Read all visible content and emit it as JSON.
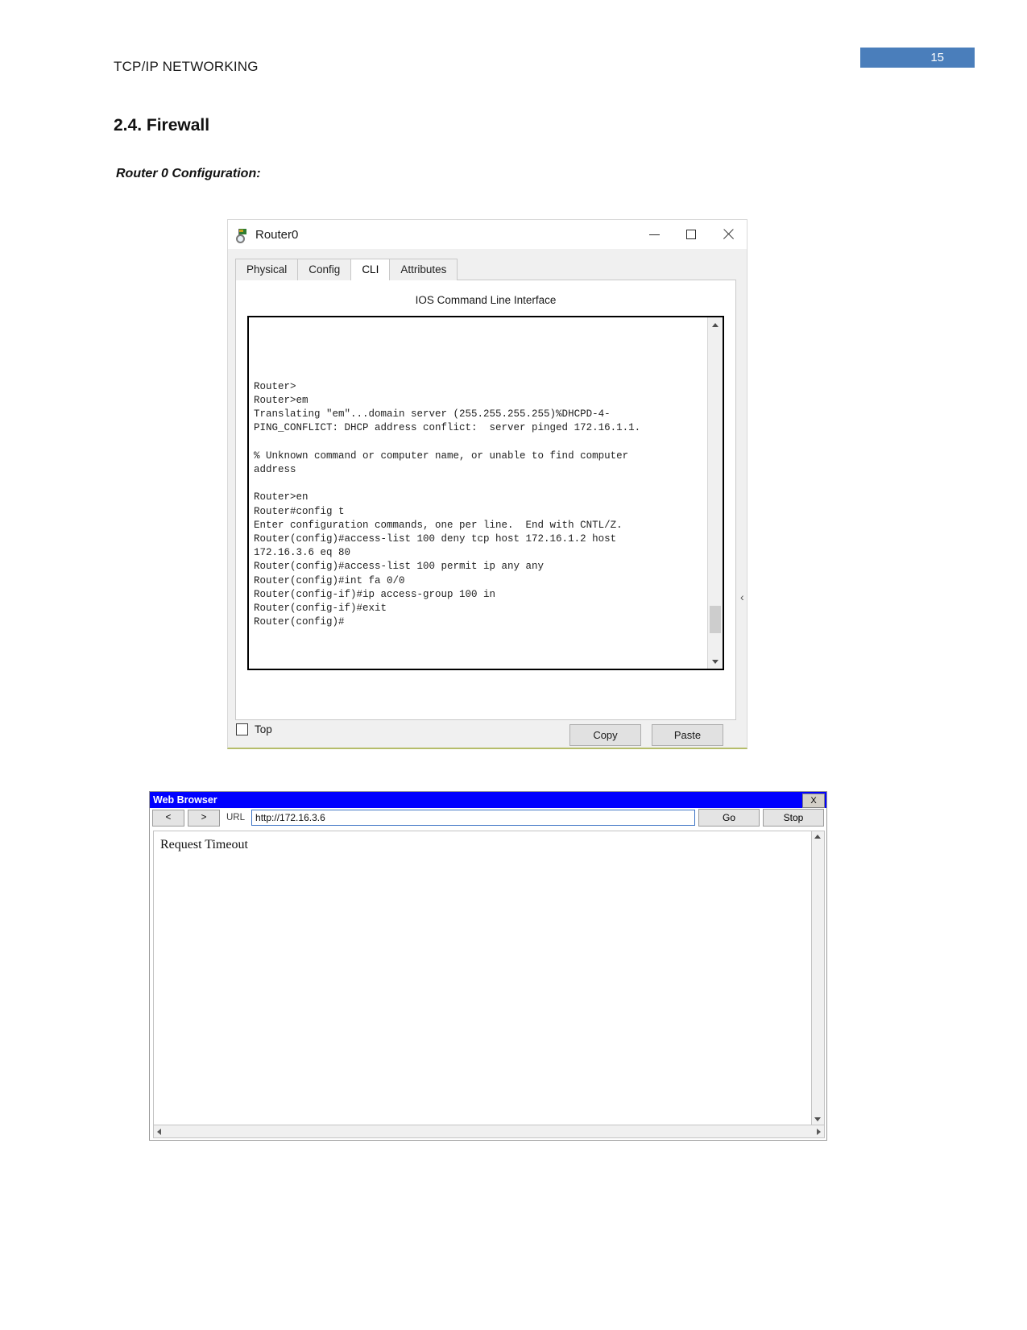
{
  "document": {
    "header_title": "TCP/IP NETWORKING",
    "page_number": "15",
    "section_heading": "2.4. Firewall",
    "sub_heading": "Router 0 Configuration:",
    "accent_color": "#4a7ebb"
  },
  "router_window": {
    "title": "Router0",
    "minimize_label": "–",
    "maximize_label": "□",
    "close_label": "✕",
    "tabs": [
      {
        "label": "Physical",
        "active": false
      },
      {
        "label": "Config",
        "active": false
      },
      {
        "label": "CLI",
        "active": true
      },
      {
        "label": "Attributes",
        "active": false
      }
    ],
    "panel_title": "IOS Command Line Interface",
    "terminal_text": "\n\n\n\nRouter>\nRouter>em\nTranslating \"em\"...domain server (255.255.255.255)%DHCPD-4-\nPING_CONFLICT: DHCP address conflict:  server pinged 172.16.1.1.\n\n% Unknown command or computer name, or unable to find computer\naddress\n\nRouter>en\nRouter#config t\nEnter configuration commands, one per line.  End with CNTL/Z.\nRouter(config)#access-list 100 deny tcp host 172.16.1.2 host\n172.16.3.6 eq 80\nRouter(config)#access-list 100 permit ip any any\nRouter(config)#int fa 0/0\nRouter(config-if)#ip access-group 100 in\nRouter(config-if)#exit\nRouter(config)#",
    "copy_button": "Copy",
    "paste_button": "Paste",
    "top_checkbox_label": "Top",
    "top_checkbox_checked": false,
    "collapse_chevron": "‹"
  },
  "web_browser": {
    "title": "Web Browser",
    "close_label": "X",
    "back_label": "<",
    "forward_label": ">",
    "url_label": "URL",
    "url_value": "http://172.16.3.6",
    "url_placeholder": "http://",
    "go_button": "Go",
    "stop_button": "Stop",
    "page_content": "Request Timeout",
    "titlebar_color": "#0000ff"
  }
}
